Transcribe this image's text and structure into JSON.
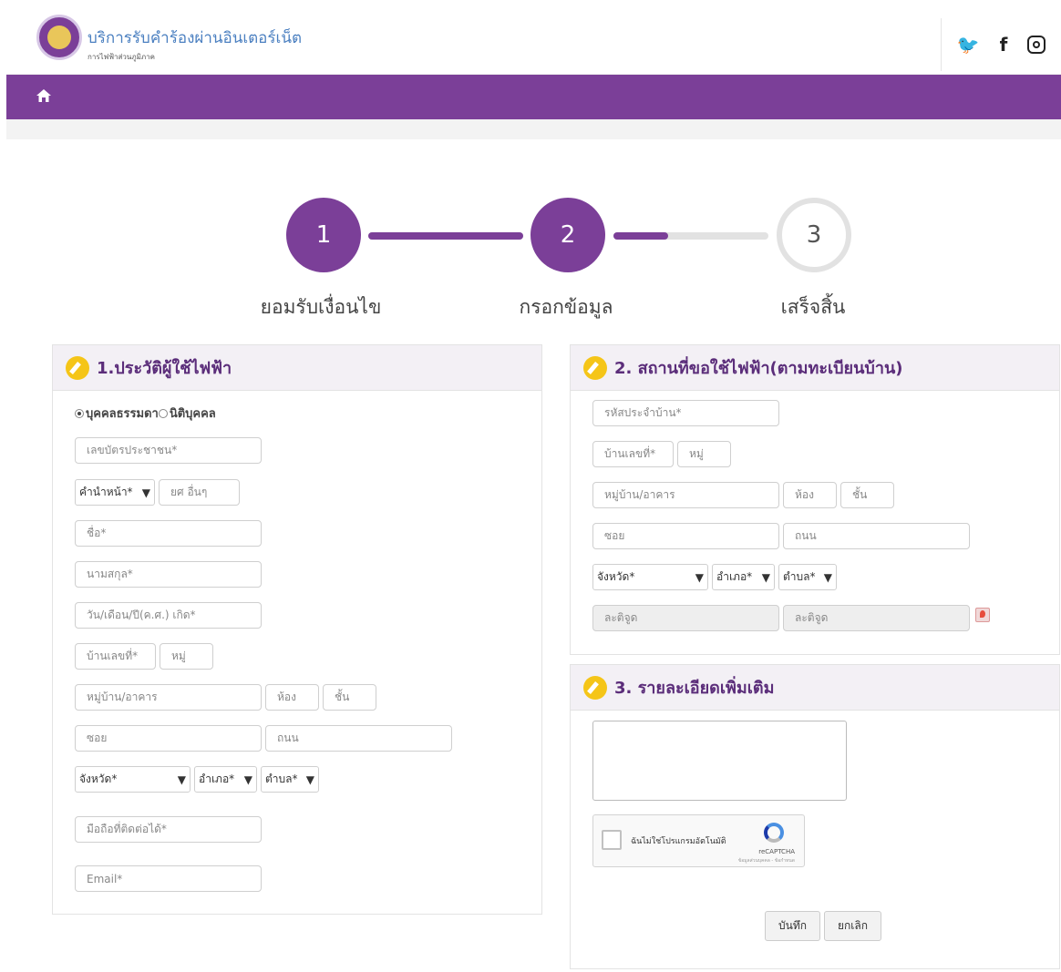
{
  "header": {
    "title": "บริการรับคำร้องผ่านอินเตอร์เน็ต",
    "subtitle": "การไฟฟ้าส่วนภูมิภาค",
    "social": [
      "twitter-icon",
      "facebook-icon",
      "instagram-icon"
    ],
    "brand_color": "#7b3f98"
  },
  "stepper": {
    "steps": [
      {
        "number": "1",
        "label": "ยอมรับเงื่อนไข"
      },
      {
        "number": "2",
        "label": "กรอกข้อมูล"
      },
      {
        "number": "3",
        "label": "เสร็จสิ้น"
      }
    ],
    "current_step": 2,
    "progress_2_to_3": 0.35
  },
  "section1": {
    "title": "1.ประวัติผู้ใช้ไฟฟ้า",
    "radio_person": "บุคคลธรรมดา",
    "radio_company": "นิติบุคคล",
    "id_card": "เลขบัตรประชาชน*",
    "prefix": "คำนำหน้า*",
    "rank": "ยศ อื่นๆ",
    "first_name": "ชื่อ*",
    "last_name": "นามสกุล*",
    "birthdate": "วัน/เดือน/ปี(ค.ศ.) เกิด*",
    "house_no": "บ้านเลขที่*",
    "moo": "หมู่",
    "village": "หมู่บ้าน/อาคาร",
    "room": "ห้อง",
    "floor": "ชั้น",
    "soi": "ซอย",
    "road": "ถนน",
    "province": "จังหวัด*",
    "district": "อำเภอ*",
    "subdistrict": "ตำบล*",
    "mobile": "มือถือที่ติดต่อได้*",
    "email": "Email*"
  },
  "section2": {
    "title": "2. สถานที่ขอใช้ไฟฟ้า(ตามทะเบียนบ้าน)",
    "house_code": "รหัสประจำบ้าน*",
    "house_no": "บ้านเลขที่*",
    "moo": "หมู่",
    "village": "หมู่บ้าน/อาคาร",
    "room": "ห้อง",
    "floor": "ชั้น",
    "soi": "ซอย",
    "road": "ถนน",
    "province": "จังหวัด*",
    "district": "อำเภอ*",
    "subdistrict": "ตำบล*",
    "latitude": "ละติจูด",
    "longitude": "ละติจูด"
  },
  "section3": {
    "title": "3. รายละเอียดเพิ่มเติม",
    "captcha_label": "ฉันไม่ใช่โปรแกรมอัตโนมัติ",
    "captcha_brand": "reCAPTCHA",
    "captcha_terms": "ข้อมูลส่วนบุคคล - ข้อกำหนด",
    "save": "บันทึก",
    "cancel": "ยกเลิก"
  }
}
